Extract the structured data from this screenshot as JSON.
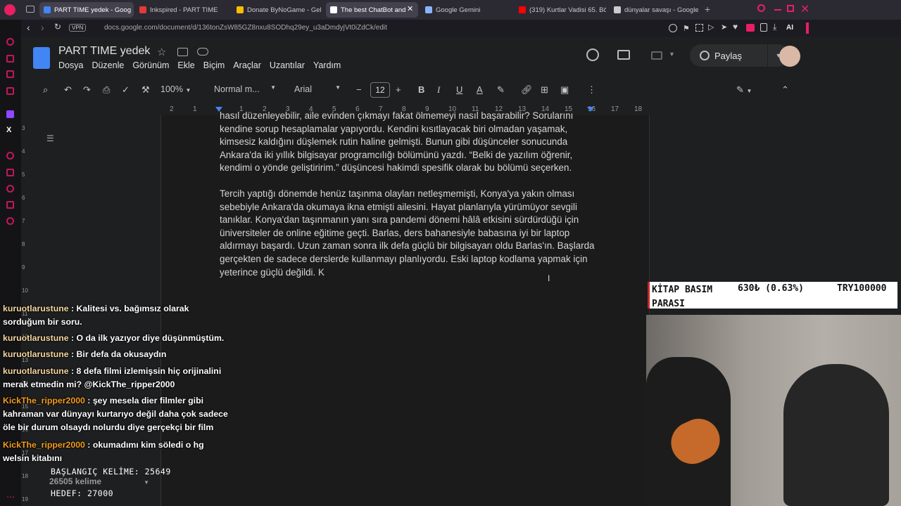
{
  "browser": {
    "tabs": [
      {
        "label": "PART TIME yedek - Goog",
        "color": "#4285f4",
        "active": true
      },
      {
        "label": "Inkspired - PART TIME",
        "color": "#e53935",
        "active": false
      },
      {
        "label": "Donate ByNoGame - Gel",
        "color": "#fbbc04",
        "active": false
      },
      {
        "label": "The best ChatBot and",
        "color": "#ffffff",
        "active": true
      },
      {
        "label": "Google Gemini",
        "color": "#8ab4f8",
        "active": false
      },
      {
        "label": "(319) Kurtlar Vadisi 65. Bö",
        "color": "#ff0000",
        "active": false
      },
      {
        "label": "dünyalar savaşı - Google'd",
        "color": "#cccccc",
        "active": false
      }
    ],
    "url": "docs.google.com/document/d/136tonZsW85GZ8nxu8SODhq29ey_u3aDmdyjVt0iZdCk/edit",
    "vpn_label": "VPN",
    "ai_label": "AI"
  },
  "docs": {
    "title": "PART TIME  yedek",
    "menu": [
      "Dosya",
      "Düzenle",
      "Görünüm",
      "Ekle",
      "Biçim",
      "Araçlar",
      "Uzantılar",
      "Yardım"
    ],
    "share_label": "Paylaş",
    "toolbar": {
      "zoom": "100%",
      "style": "Normal m...",
      "font": "Arial",
      "font_size": "12"
    },
    "ruler": [
      "2",
      "1",
      "1",
      "2",
      "3",
      "4",
      "5",
      "6",
      "7",
      "8",
      "9",
      "10",
      "11",
      "12",
      "13",
      "14",
      "15",
      "16",
      "17",
      "18"
    ],
    "vruler": [
      "3",
      "4",
      "5",
      "6",
      "7",
      "8",
      "9",
      "10",
      "11",
      "12",
      "13",
      "14",
      "15",
      "16",
      "17",
      "18",
      "19"
    ],
    "paragraphs": [
      "hasıl düzenleyebilir, aile evinden çıkmayı fakat ölmemeyi nasıl başarabilir? Sorularını kendine sorup hesaplamalar yapıyordu. Kendini kısıtlayacak biri olmadan yaşamak, kimsesiz kaldığını düşlemek rutin haline gelmişti. Bunun gibi düşünceler sonucunda Ankara'da iki yıllık bilgisayar programcılığı bölümünü yazdı. “Belki de yazılım öğrenir, kendimi o yönde geliştiririm.” düşüncesi hakimdi spesifik olarak bu bölümü seçerken.",
      "Tercih yaptığı dönemde henüz taşınma olayları netleşmemişti, Konya'ya yakın olması sebebiyle Ankara'da okumaya ikna etmişti ailesini. Hayat planlarıyla yürümüyor sevgili tanıklar. Konya'dan taşınmanın yanı sıra pandemi dönemi hâlâ etkisini sürdürdüğü için üniversiteler de online eğitime geçti. Barlas, ders bahanesiyle babasına iyi bir laptop aldırmayı başardı. Uzun zaman sonra ilk defa güçlü bir bilgisayarı oldu Barlas'ın. Başlarda gerçekten de sadece derslerde kullanmayı planlıyordu. Eski laptop kodlama yapmak için yeterince güçlü değildi. K"
    ],
    "word_count": "26505 kelime"
  },
  "chat": [
    {
      "user": "kuruotlarustune",
      "msg": "Kalitesi vs. bağımsız olarak sorduğum bir soru.",
      "style": "u1"
    },
    {
      "user": "kuruotlarustune",
      "msg": "O da ilk yazıyor diye düşünmüştüm.",
      "style": "u1"
    },
    {
      "user": "kuruotlarustune",
      "msg": "Bir defa da okusaydın",
      "style": "u1"
    },
    {
      "user": "kuruotlarustune",
      "msg": "8 defa filmi izlemişsin hiç orijinalini merak etmedin mi? @KickThe_ripper2000",
      "style": "u1"
    },
    {
      "user": "KickThe_ripper2000",
      "msg": "şey mesela dier filmler gibi kahraman var dünyayı kurtarıyo değil daha çok sadece öle bir durum olsaydı nolurdu diye gerçekçi bir film",
      "style": "u2"
    },
    {
      "user": "KickThe_ripper2000",
      "msg": "okumadımı kim söledi o hg welsin kitabını",
      "style": "u2"
    }
  ],
  "stream": {
    "goal_title": "KİTAP BASIM PARASI",
    "goal_progress": "630₺ (0.63%)",
    "goal_target": "TRY100000",
    "start_words": "BAŞLANGIÇ KELİME: 25649",
    "target_words": "HEDEF: 27000"
  }
}
